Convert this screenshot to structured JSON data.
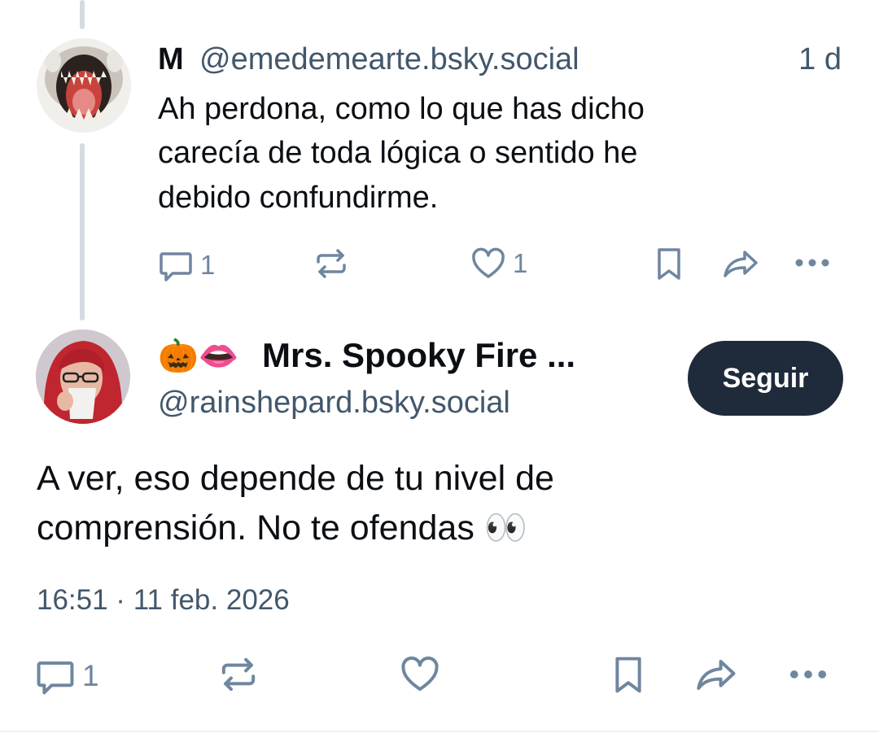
{
  "colors": {
    "text": "#0b0f14",
    "muted": "#42576c",
    "icon": "#6f869f",
    "button_bg": "#1f2b3a",
    "thread_line": "#d4dbe2"
  },
  "parent_post": {
    "author_name": "M",
    "author_handle": "@emedemearte.bsky.social",
    "age": "1 d",
    "text_lines": [
      "Ah perdona, como lo que has dicho",
      "carecía de toda lógica o sentido he",
      "debido confundirme."
    ],
    "actions": {
      "reply_icon": "reply-icon",
      "reply_count": "1",
      "repost_icon": "repost-icon",
      "like_icon": "heart-icon",
      "like_count": "1",
      "bookmark_icon": "bookmark-icon",
      "share_icon": "share-icon",
      "more_icon": "more-icon"
    }
  },
  "main_post": {
    "author_emojis": "🎃👄",
    "author_name": "Mrs. Spooky Fire ...",
    "author_handle": "@rainshepard.bsky.social",
    "follow_label": "Seguir",
    "text_lines": [
      "A ver, eso depende de tu nivel de",
      "comprensión. No te ofendas 👀"
    ],
    "timestamp": "16:51 · 11 feb. 2026",
    "actions": {
      "reply_count": "1"
    }
  }
}
